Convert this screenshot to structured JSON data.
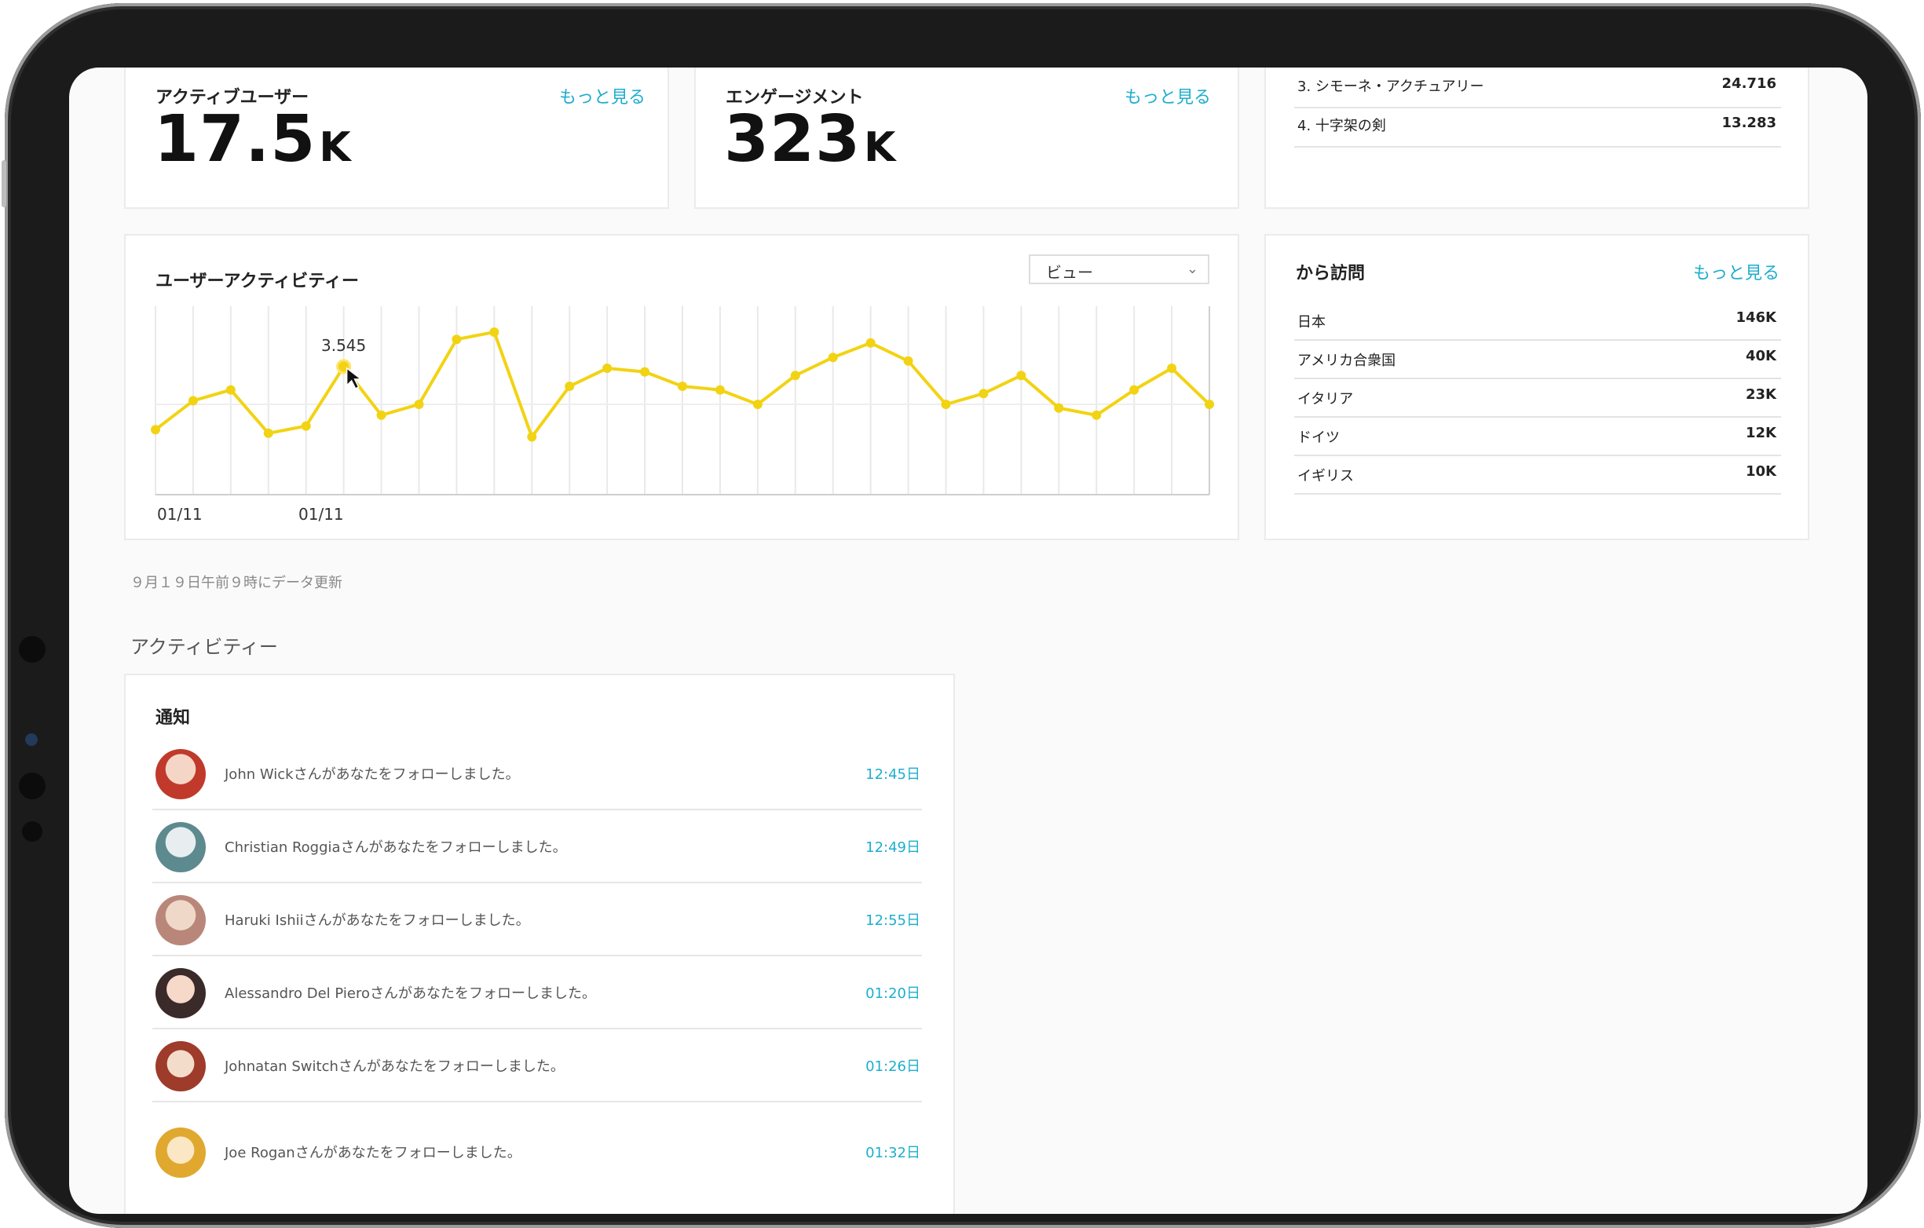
{
  "stats": [
    {
      "title": "アクティブユーザー",
      "link": "もっと見る",
      "value": "17.5",
      "unit": "K"
    },
    {
      "title": "エンゲージメント",
      "link": "もっと見る",
      "value": "323",
      "unit": "K"
    }
  ],
  "ranking": [
    {
      "name": "3.  シモーネ・アクチュアリー",
      "value": "24.716"
    },
    {
      "name": "4.  十字架の剣",
      "value": "13.283"
    }
  ],
  "activity_chart": {
    "title": "ユーザーアクティビティー",
    "dropdown_value": "ビュー",
    "highlight_label": "3.545",
    "x_labels": [
      "01/11",
      "01/11"
    ]
  },
  "chart_data": {
    "type": "line",
    "x": [
      1,
      2,
      3,
      4,
      5,
      6,
      7,
      8,
      9,
      10,
      11,
      12,
      13,
      14,
      15,
      16,
      17,
      18,
      19,
      20,
      21,
      22,
      23,
      24,
      25,
      26,
      27,
      28,
      29
    ],
    "values": [
      1.8,
      2.6,
      2.9,
      1.7,
      1.9,
      3.545,
      2.2,
      2.5,
      4.3,
      4.5,
      1.6,
      3.0,
      3.5,
      3.4,
      3.0,
      2.9,
      2.5,
      3.3,
      3.8,
      4.2,
      3.7,
      2.5,
      2.8,
      3.3,
      2.4,
      2.2,
      2.9,
      3.5,
      2.5
    ],
    "ylim": [
      0,
      5
    ],
    "highlight_index": 5,
    "color": "#f2d313",
    "grid": "vertical"
  },
  "visits": {
    "title": "から訪問",
    "link": "もっと見る",
    "rows": [
      {
        "country": "日本",
        "value": "146K"
      },
      {
        "country": "アメリカ合衆国",
        "value": "40K"
      },
      {
        "country": "イタリア",
        "value": "23K"
      },
      {
        "country": "ドイツ",
        "value": "12K"
      },
      {
        "country": "イギリス",
        "value": "10K"
      }
    ]
  },
  "update_note": "９月１９日午前９時にデータ更新",
  "activity_section_title": "アクティビティー",
  "notifications": {
    "title": "通知",
    "items": [
      {
        "text": "John Wickさんがあなたをフォローしました。",
        "time": "12:45日",
        "avatar_color": "#c0392b"
      },
      {
        "text": "Christian Roggiaさんがあなたをフォローしました。",
        "time": "12:49日",
        "avatar_color": "#5d8a8f"
      },
      {
        "text": "Haruki Ishiiさんがあなたをフォローしました。",
        "time": "12:55日",
        "avatar_color": "#b9877a"
      },
      {
        "text": "Alessandro Del Pieroさんがあなたをフォローしました。",
        "time": "01:20日",
        "avatar_color": "#3b2a2a"
      },
      {
        "text": "Johnatan Switchさんがあなたをフォローしました。",
        "time": "01:26日",
        "avatar_color": "#9e3b2a"
      },
      {
        "text": "Joe Roganさんがあなたをフォローしました。",
        "time": "01:32日",
        "avatar_color": "#e0a82e"
      }
    ]
  },
  "colors": {
    "accent": "#1eaecd",
    "line": "#f2d313"
  }
}
